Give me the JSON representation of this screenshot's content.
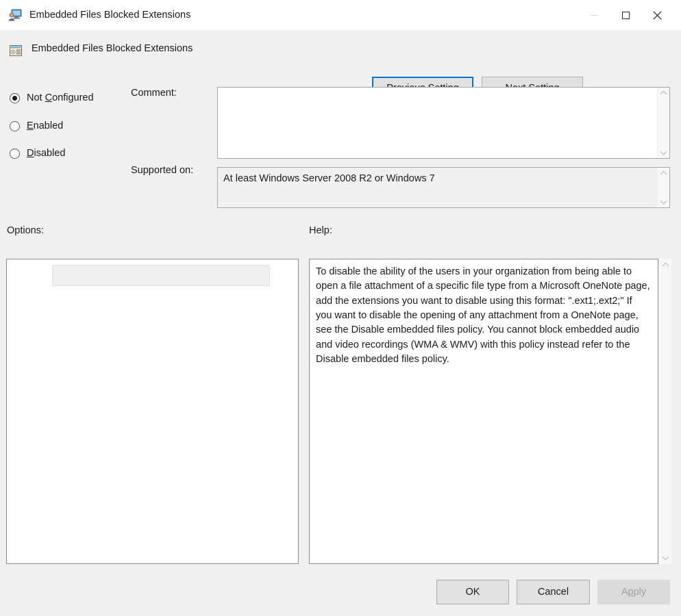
{
  "window": {
    "title": "Embedded Files Blocked Extensions",
    "icon": "user-policy-monitor-icon",
    "controls": {
      "minimize_label": "minimize-icon",
      "maximize_label": "maximize-icon",
      "close_label": "close-icon"
    }
  },
  "setting_header": {
    "icon": "policy-setting-icon",
    "title": "Embedded Files Blocked Extensions",
    "prev_setting": {
      "pre": "",
      "mnemonic": "P",
      "post": "revious Setting"
    },
    "next_setting": {
      "pre": "",
      "mnemonic": "N",
      "post": "ext Setting"
    }
  },
  "state_radios": {
    "selected": "Not Configured",
    "items": [
      {
        "id": "not-configured",
        "pre": "Not ",
        "mnemonic": "C",
        "post": "onfigured",
        "checked": true
      },
      {
        "id": "enabled",
        "pre": "",
        "mnemonic": "E",
        "post": "nabled",
        "checked": false
      },
      {
        "id": "disabled",
        "pre": "",
        "mnemonic": "D",
        "post": "isabled",
        "checked": false
      }
    ]
  },
  "comment": {
    "label": "Comment:",
    "value": "",
    "placeholder": ""
  },
  "supported_on": {
    "label": "Supported on:",
    "value": "At least Windows Server 2008 R2 or Windows 7"
  },
  "options": {
    "label": "Options:",
    "blocked_extensions": {
      "value": "",
      "placeholder": "",
      "enabled": false
    }
  },
  "help": {
    "label": "Help:",
    "text": "To disable the ability of the users in your organization from being able to open a file attachment of a specific file type from a Microsoft OneNote page, add the extensions you want to disable using this format: \".ext1;.ext2;\" If you want to disable the opening of any attachment from a OneNote page, see the Disable embedded files policy. You cannot block embedded audio and video recordings (WMA & WMV) with this policy instead refer to the Disable embedded files policy."
  },
  "footer": {
    "ok_label": "OK",
    "cancel_label": "Cancel",
    "apply": {
      "pre": "A",
      "mnemonic": "p",
      "post": "ply",
      "enabled": false
    }
  },
  "colors": {
    "window_background": "#f0f0f0",
    "titlebar_background": "#ffffff",
    "accent_focus": "#0078d7",
    "panel_background": "#ffffff",
    "button_face": "#e1e1e1",
    "disabled_text": "#a0a0a0"
  }
}
